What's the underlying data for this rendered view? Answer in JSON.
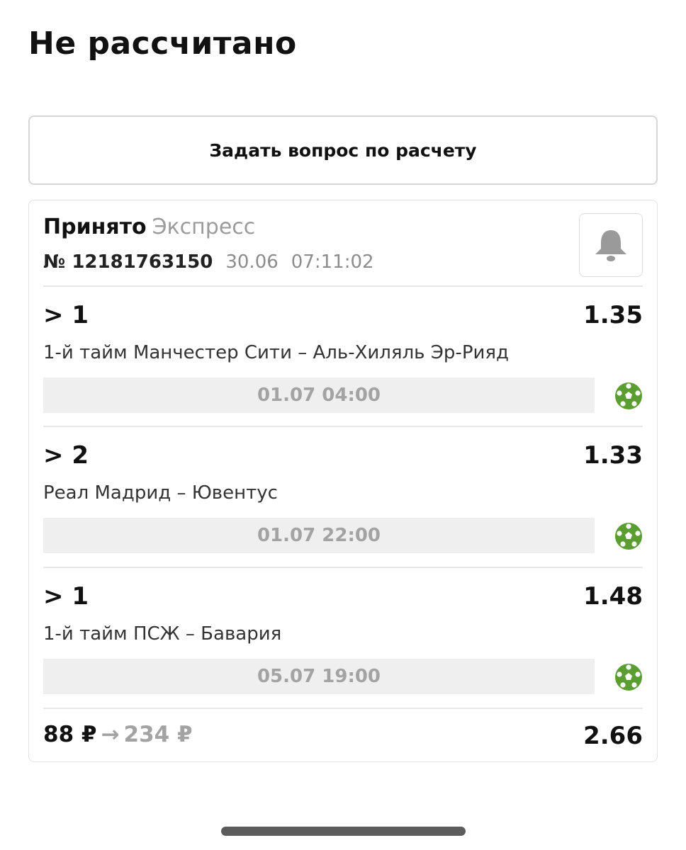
{
  "page": {
    "title": "Не рассчитано"
  },
  "ask_button": {
    "label": "Задать вопрос по расчету"
  },
  "bet": {
    "status": "Принято",
    "type": "Экспресс",
    "number": "№ 12181763150",
    "date": "30.06",
    "time": "07:11:02",
    "bell_icon": "bell-icon"
  },
  "events": [
    {
      "outcome": "> 1",
      "odds": "1.35",
      "match": "1-й тайм Манчестер Сити – Аль-Хиляль Эр-Рияд",
      "datetime": "01.07 04:00",
      "sport_icon": "soccer-ball-icon"
    },
    {
      "outcome": "> 2",
      "odds": "1.33",
      "match": "Реал Мадрид – Ювентус",
      "datetime": "01.07 22:00",
      "sport_icon": "soccer-ball-icon"
    },
    {
      "outcome": "> 1",
      "odds": "1.48",
      "match": "1-й тайм ПСЖ – Бавария",
      "datetime": "05.07 19:00",
      "sport_icon": "soccer-ball-icon"
    }
  ],
  "summary": {
    "stake": "88 ₽",
    "arrow": "→",
    "payout": "234 ₽",
    "total_odds": "2.66"
  },
  "colors": {
    "accent_green": "#5a9e32",
    "muted_text": "#9b9b9b",
    "date_bar_bg": "#efefef"
  }
}
